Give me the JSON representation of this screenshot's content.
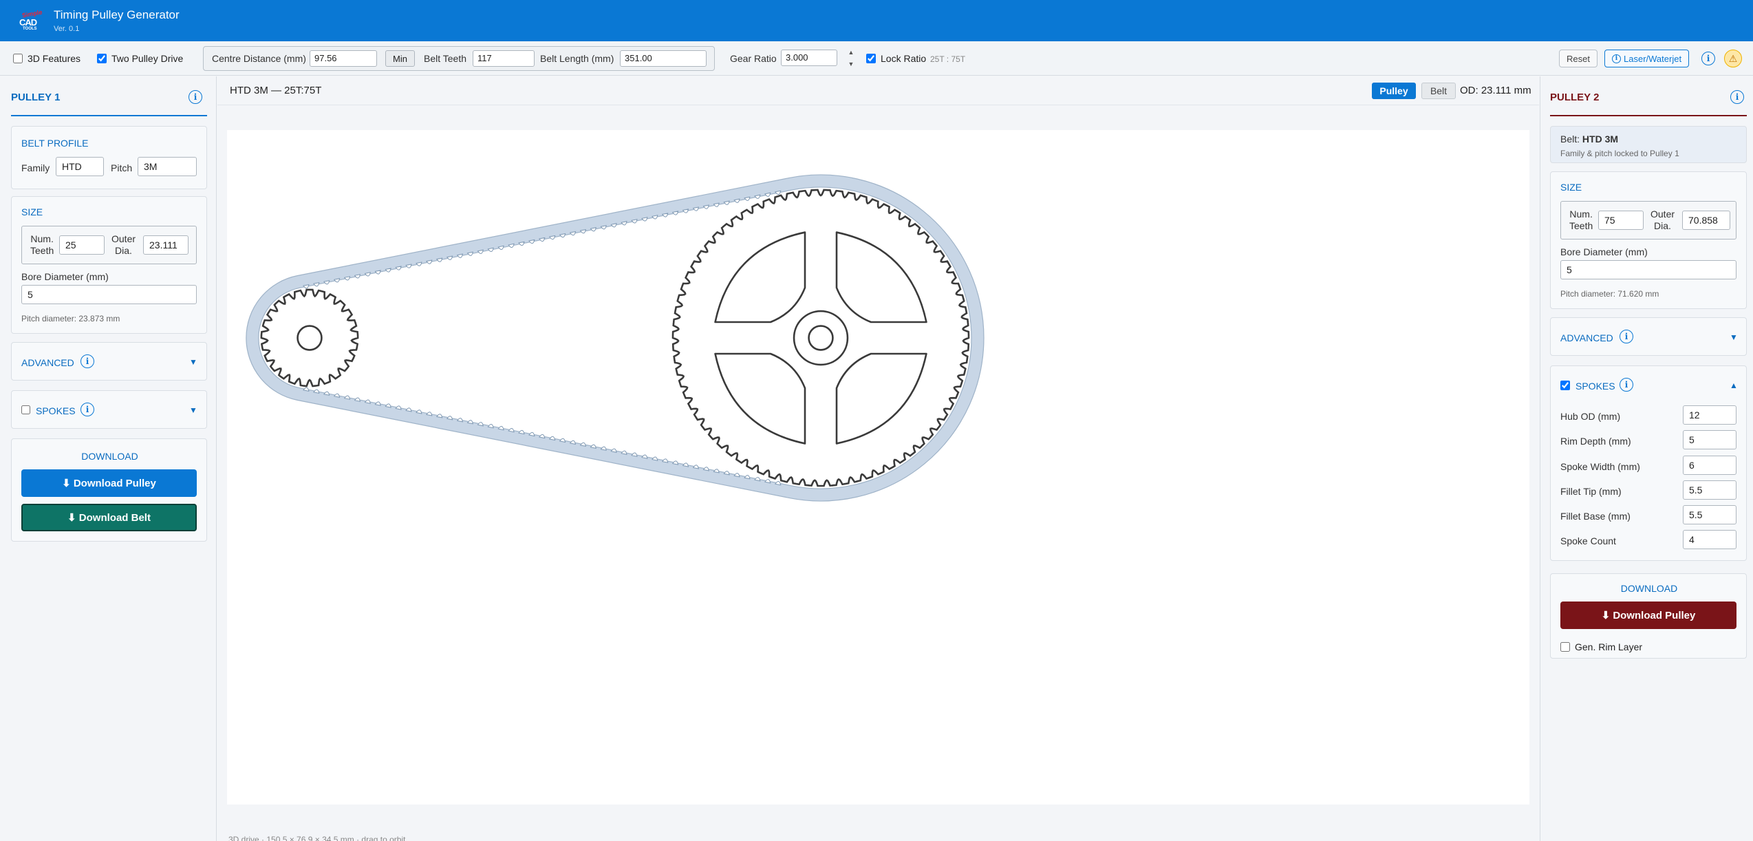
{
  "app": {
    "title": "Timing Pulley Generator",
    "version": "Ver. 0.1",
    "logo_top": "Simple",
    "logo_main": "CAD",
    "logo_bottom": "TOOLS"
  },
  "toolbar": {
    "features_3d": "3D Features",
    "two_pulley": "Two Pulley Drive",
    "centre_distance_label": "Centre Distance (mm)",
    "centre_distance": "97.56",
    "min_label": "Min",
    "belt_teeth_label": "Belt Teeth",
    "belt_teeth": "117",
    "belt_length_label": "Belt Length (mm)",
    "belt_length": "351.00",
    "gear_ratio_label": "Gear Ratio",
    "gear_ratio": "3.000",
    "lock_ratio_label": "Lock Ratio",
    "lock_ratio_text": "25T : 75T",
    "reset": "Reset",
    "laser": "Laser/Waterjet",
    "info_glyph": "i",
    "warn_glyph": "⚠"
  },
  "pulley1": {
    "title": "PULLEY 1",
    "belt_profile_title": "BELT PROFILE",
    "family_label": "Family",
    "family": "HTD",
    "pitch_label": "Pitch",
    "pitch": "3M",
    "size_title": "SIZE",
    "num_teeth_label": "Num. Teeth",
    "num_teeth_l1": "Num.",
    "num_teeth_l2": "Teeth",
    "num_teeth": "25",
    "outer_l1": "Outer",
    "outer_l2": "Dia.",
    "outer_dia": "23.111",
    "bore_label": "Bore Diameter (mm)",
    "bore": "5",
    "pitch_dia": "Pitch diameter: 23.873 mm",
    "advanced": "ADVANCED",
    "spokes": "SPOKES",
    "download_title": "DOWNLOAD",
    "download_pulley": "⬇ Download Pulley",
    "download_belt": "⬇ Download Belt"
  },
  "center": {
    "heading": "HTD 3M — 25T:75T",
    "tab_pulley": "Pulley",
    "tab_belt": "Belt",
    "od": "OD: 23.111 mm",
    "footnote": "3D drive · 150.5 × 76.9 × 34.5 mm · drag to orbit"
  },
  "pulley2": {
    "title": "PULLEY 2",
    "belt_prefix": "Belt:",
    "belt_name": "HTD 3M",
    "locked_note": "Family & pitch locked to Pulley 1",
    "size_title": "SIZE",
    "num_teeth_l1": "Num.",
    "num_teeth_l2": "Teeth",
    "num_teeth": "75",
    "outer_l1": "Outer",
    "outer_l2": "Dia.",
    "outer_dia": "70.858",
    "bore_label": "Bore Diameter (mm)",
    "bore": "5",
    "pitch_dia": "Pitch diameter: 71.620 mm",
    "advanced": "ADVANCED",
    "spokes": "SPOKES",
    "hub_od_label": "Hub OD (mm)",
    "hub_od": "12",
    "rim_depth_label": "Rim Depth (mm)",
    "rim_depth": "5",
    "spoke_width_label": "Spoke Width (mm)",
    "spoke_width": "6",
    "fillet_tip_label": "Fillet Tip (mm)",
    "fillet_tip": "5.5",
    "fillet_base_label": "Fillet Base (mm)",
    "fillet_base": "5.5",
    "spoke_count_label": "Spoke Count",
    "spoke_count": "4",
    "download_title": "DOWNLOAD",
    "download_pulley": "⬇ Download Pulley",
    "gen_rim": "Gen. Rim Layer"
  },
  "colors": {
    "brand": "#0a78d4",
    "pulley2": "#7a1418",
    "belt_btn": "#0e7466",
    "belt_fill": "#c8d6e6"
  }
}
